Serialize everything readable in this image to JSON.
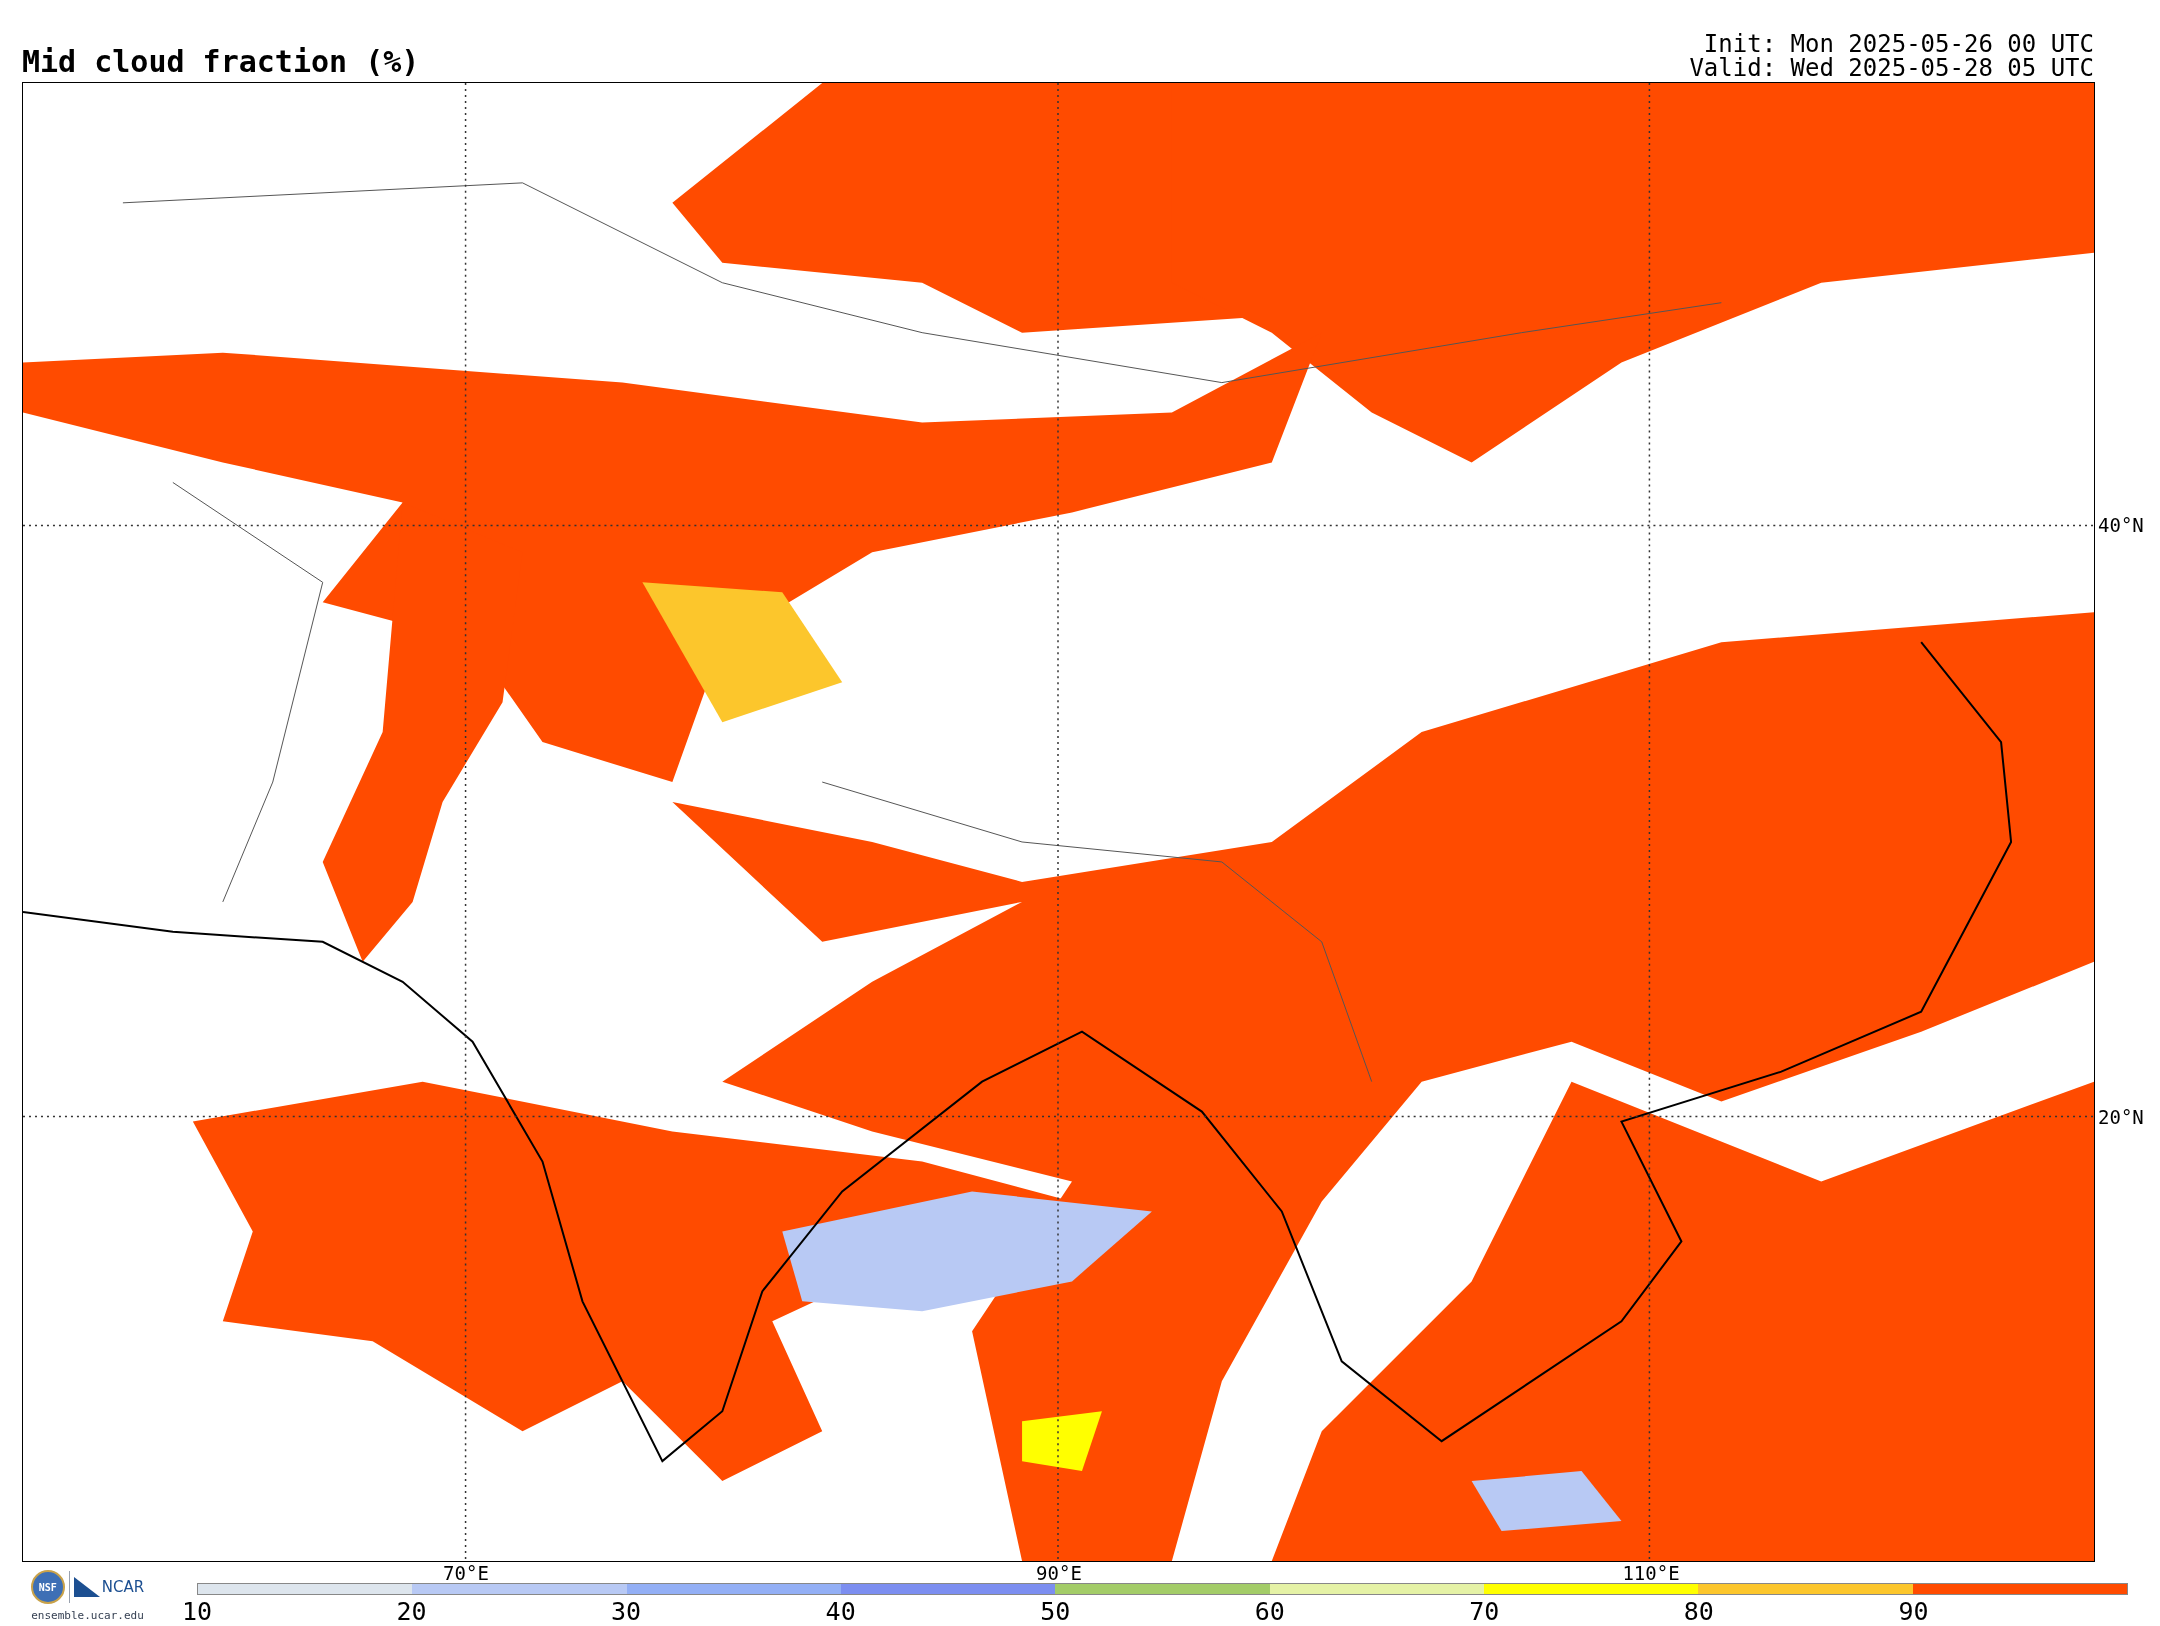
{
  "title": "Mid cloud fraction (%)",
  "run_info": [
    "Init: Mon 2025-05-26 00 UTC",
    "Valid: Wed 2025-05-28 05 UTC"
  ],
  "map": {
    "latitude_labels": [
      "40°N",
      "20°N"
    ],
    "longitude_labels": [
      "70°E",
      "90°E",
      "110°E"
    ]
  },
  "logo": {
    "left": "NSF",
    "right": "NCAR",
    "url": "ensemble.ucar.edu"
  },
  "colorbar": {
    "segments": [
      {
        "color": "#dde5ed"
      },
      {
        "color": "#b8c9f4"
      },
      {
        "color": "#93aff5"
      },
      {
        "color": "#7c8ef0"
      },
      {
        "color": "#a3cc68"
      },
      {
        "color": "#e5f2a6"
      },
      {
        "color": "#ffff00"
      },
      {
        "color": "#fcc62c"
      },
      {
        "color": "#ff4b00"
      }
    ],
    "labels": [
      "10",
      "20",
      "30",
      "40",
      "50",
      "60",
      "70",
      "80",
      "90"
    ]
  }
}
